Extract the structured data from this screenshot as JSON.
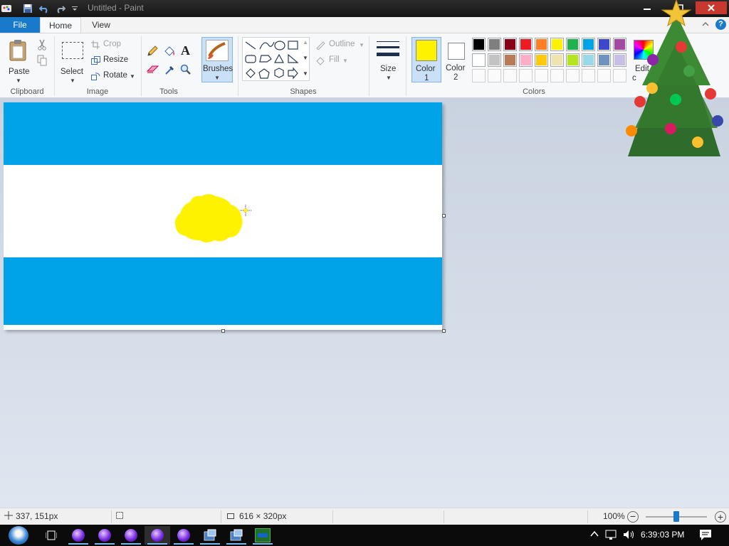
{
  "window": {
    "title": "Untitled - Paint"
  },
  "tabs": [
    {
      "label": "File"
    },
    {
      "label": "Home"
    },
    {
      "label": "View"
    }
  ],
  "clipboard": {
    "paste_label": "Paste",
    "group_label": "Clipboard"
  },
  "image": {
    "select_label": "Select",
    "crop_label": "Crop",
    "resize_label": "Resize",
    "rotate_label": "Rotate",
    "group_label": "Image"
  },
  "tools": {
    "group_label": "Tools"
  },
  "brushes": {
    "label": "Brushes"
  },
  "shapes": {
    "outline_label": "Outline",
    "fill_label": "Fill",
    "group_label": "Shapes"
  },
  "size": {
    "label": "Size"
  },
  "colors": {
    "color1_label": "Color",
    "color1_num": "1",
    "color2_label": "Color",
    "color2_num": "2",
    "edit_label": "Edit",
    "edit_label2": "c",
    "group_label": "Colors",
    "color1": "#fff200",
    "color2": "#ffffff",
    "palette_row1": [
      "#000000",
      "#7f7f7f",
      "#880015",
      "#ed1c24",
      "#ff7f27",
      "#fff200",
      "#22b14c",
      "#00a2e8",
      "#3f48cc",
      "#a349a4"
    ],
    "palette_row2": [
      "#ffffff",
      "#c3c3c3",
      "#b97a57",
      "#ffaec9",
      "#ffc90e",
      "#efe4b0",
      "#b5e61d",
      "#99d9ea",
      "#7092be",
      "#c8bfe7"
    ]
  },
  "canvas": {
    "stripe_color": "#00a2e8",
    "sun_color": "#fff200"
  },
  "status": {
    "cursor_pos": "337, 151px",
    "canvas_size": "616 × 320px",
    "zoom": "100%"
  },
  "taskbar": {
    "clock": "6:39:03 PM"
  }
}
